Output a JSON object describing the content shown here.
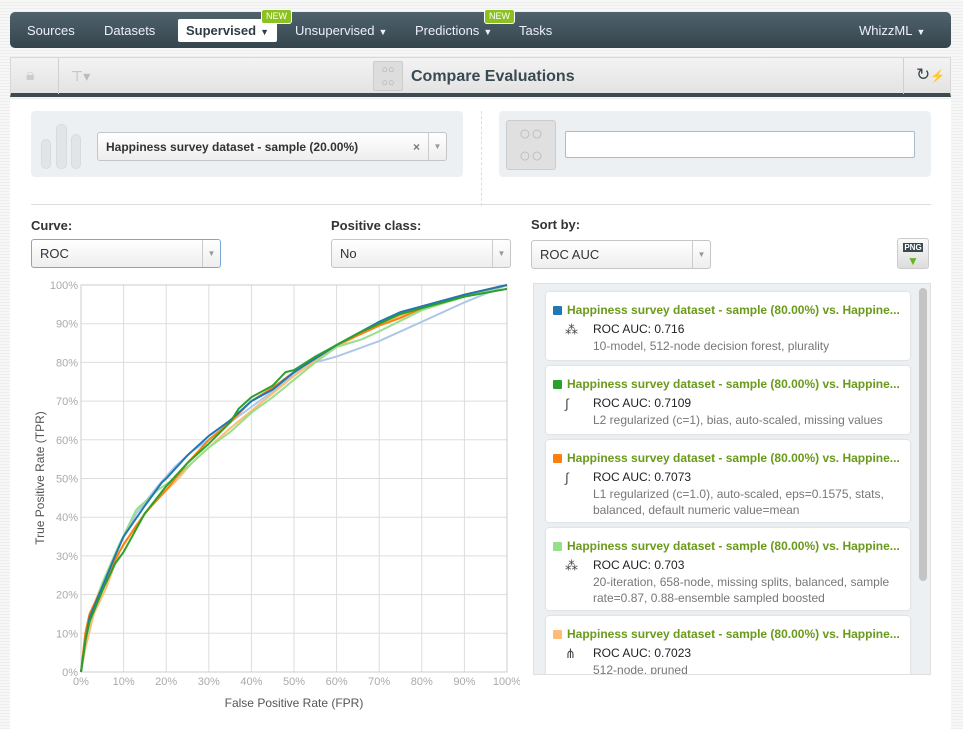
{
  "nav": {
    "items": [
      "Sources",
      "Datasets",
      "Supervised",
      "Unsupervised",
      "Predictions",
      "Tasks"
    ],
    "right": "WhizzML",
    "badge": "NEW",
    "active": "Supervised"
  },
  "toolbar": {
    "title": "Compare Evaluations",
    "icons": [
      "lock-icon",
      "tree-icon",
      "compare-icon",
      "refresh-lightning-icon"
    ]
  },
  "selection": {
    "dataset": "Happiness survey dataset - sample (20.00%)",
    "clear": "×",
    "search_value": ""
  },
  "controls": {
    "curve_label": "Curve:",
    "curve_value": "ROC",
    "positive_label": "Positive class:",
    "positive_value": "No",
    "sort_label": "Sort by:",
    "sort_value": "ROC AUC",
    "png": "PNG"
  },
  "evaluations": [
    {
      "title": "Happiness survey dataset - sample (80.00%) vs. Happine...",
      "auc": "ROC AUC: 0.716",
      "desc": "10-model, 512-node decision forest, plurality",
      "color": "#1f77b4",
      "icon": "ensemble-icon"
    },
    {
      "title": "Happiness survey dataset - sample (80.00%) vs. Happine...",
      "auc": "ROC AUC: 0.7109",
      "desc": "L2 regularized (c=1), bias, auto-scaled, missing values",
      "color": "#2ca02c",
      "icon": "logistic-regression-icon"
    },
    {
      "title": "Happiness survey dataset - sample (80.00%) vs. Happine...",
      "auc": "ROC AUC: 0.7073",
      "desc": "L1 regularized (c=1.0), auto-scaled, eps=0.1575, stats, balanced, default numeric value=mean",
      "color": "#ff7f0e",
      "icon": "logistic-regression-icon"
    },
    {
      "title": "Happiness survey dataset - sample (80.00%) vs. Happine...",
      "auc": "ROC AUC: 0.703",
      "desc": "20-iteration, 658-node, missing splits, balanced, sample rate=0.87, 0.88-ensemble sampled boosted",
      "color": "#98df8a",
      "icon": "ensemble-icon"
    },
    {
      "title": "Happiness survey dataset - sample (80.00%) vs. Happine...",
      "auc": "ROC AUC: 0.7023",
      "desc": "512-node, pruned",
      "color": "#ffbb78",
      "icon": "model-icon"
    }
  ],
  "chart_data": {
    "type": "line",
    "xlabel": "False Positive Rate (FPR)",
    "ylabel": "True Positive Rate (TPR)",
    "xlim": [
      0,
      1
    ],
    "ylim": [
      0,
      1
    ],
    "grid": true,
    "xticks": [
      "0%",
      "10%",
      "20%",
      "30%",
      "40%",
      "50%",
      "60%",
      "70%",
      "80%",
      "90%",
      "100%"
    ],
    "yticks": [
      "0%",
      "10%",
      "20%",
      "30%",
      "40%",
      "50%",
      "60%",
      "70%",
      "80%",
      "90%",
      "100%"
    ],
    "series": [
      {
        "color": "#aec7e8",
        "x": [
          0,
          0.01,
          0.03,
          0.06,
          0.09,
          0.13,
          0.18,
          0.22,
          0.26,
          0.3,
          0.35,
          0.4,
          0.45,
          0.5,
          0.55,
          0.6,
          0.7,
          0.8,
          0.9,
          1
        ],
        "y": [
          0,
          0.07,
          0.15,
          0.25,
          0.33,
          0.41,
          0.48,
          0.53,
          0.57,
          0.6,
          0.645,
          0.685,
          0.725,
          0.77,
          0.8,
          0.815,
          0.855,
          0.905,
          0.955,
          1
        ]
      },
      {
        "color": "#ffbb78",
        "x": [
          0,
          0.01,
          0.03,
          0.06,
          0.09,
          0.13,
          0.18,
          0.22,
          0.26,
          0.3,
          0.35,
          0.4,
          0.45,
          0.5,
          0.55,
          0.6,
          0.65,
          0.7,
          0.8,
          0.9,
          1
        ],
        "y": [
          0,
          0.06,
          0.15,
          0.22,
          0.31,
          0.38,
          0.45,
          0.49,
          0.54,
          0.58,
          0.63,
          0.675,
          0.72,
          0.765,
          0.805,
          0.84,
          0.87,
          0.895,
          0.945,
          0.975,
          1
        ]
      },
      {
        "color": "#98df8a",
        "x": [
          0,
          0.01,
          0.03,
          0.05,
          0.09,
          0.13,
          0.18,
          0.22,
          0.26,
          0.3,
          0.35,
          0.4,
          0.45,
          0.5,
          0.55,
          0.6,
          0.66,
          0.7,
          0.8,
          0.9,
          1
        ],
        "y": [
          0,
          0.08,
          0.17,
          0.23,
          0.33,
          0.42,
          0.47,
          0.5,
          0.54,
          0.58,
          0.62,
          0.67,
          0.71,
          0.755,
          0.8,
          0.84,
          0.86,
          0.88,
          0.935,
          0.97,
          1
        ]
      },
      {
        "color": "#ff7f0e",
        "x": [
          0,
          0.01,
          0.02,
          0.05,
          0.08,
          0.1,
          0.15,
          0.2,
          0.25,
          0.3,
          0.35,
          0.4,
          0.45,
          0.5,
          0.55,
          0.6,
          0.65,
          0.7,
          0.75,
          0.8,
          0.9,
          1
        ],
        "y": [
          0,
          0.1,
          0.15,
          0.22,
          0.29,
          0.33,
          0.41,
          0.47,
          0.54,
          0.6,
          0.645,
          0.7,
          0.735,
          0.775,
          0.81,
          0.845,
          0.87,
          0.895,
          0.915,
          0.94,
          0.975,
          1
        ]
      },
      {
        "color": "#1f77b4",
        "x": [
          0,
          0.01,
          0.02,
          0.05,
          0.08,
          0.1,
          0.15,
          0.19,
          0.2,
          0.25,
          0.3,
          0.35,
          0.4,
          0.45,
          0.5,
          0.55,
          0.6,
          0.65,
          0.7,
          0.75,
          0.8,
          0.9,
          1
        ],
        "y": [
          0,
          0.08,
          0.14,
          0.22,
          0.3,
          0.35,
          0.43,
          0.49,
          0.5,
          0.56,
          0.61,
          0.65,
          0.7,
          0.73,
          0.775,
          0.81,
          0.845,
          0.875,
          0.905,
          0.93,
          0.945,
          0.975,
          1
        ]
      },
      {
        "color": "#2ca02c",
        "x": [
          0,
          0.01,
          0.02,
          0.05,
          0.08,
          0.1,
          0.15,
          0.2,
          0.25,
          0.3,
          0.35,
          0.37,
          0.4,
          0.45,
          0.48,
          0.5,
          0.55,
          0.6,
          0.65,
          0.7,
          0.75,
          0.8,
          0.9,
          1
        ],
        "y": [
          0,
          0.08,
          0.13,
          0.21,
          0.28,
          0.31,
          0.41,
          0.48,
          0.54,
          0.59,
          0.645,
          0.68,
          0.71,
          0.74,
          0.775,
          0.78,
          0.815,
          0.845,
          0.875,
          0.9,
          0.925,
          0.94,
          0.97,
          0.99
        ]
      }
    ]
  }
}
